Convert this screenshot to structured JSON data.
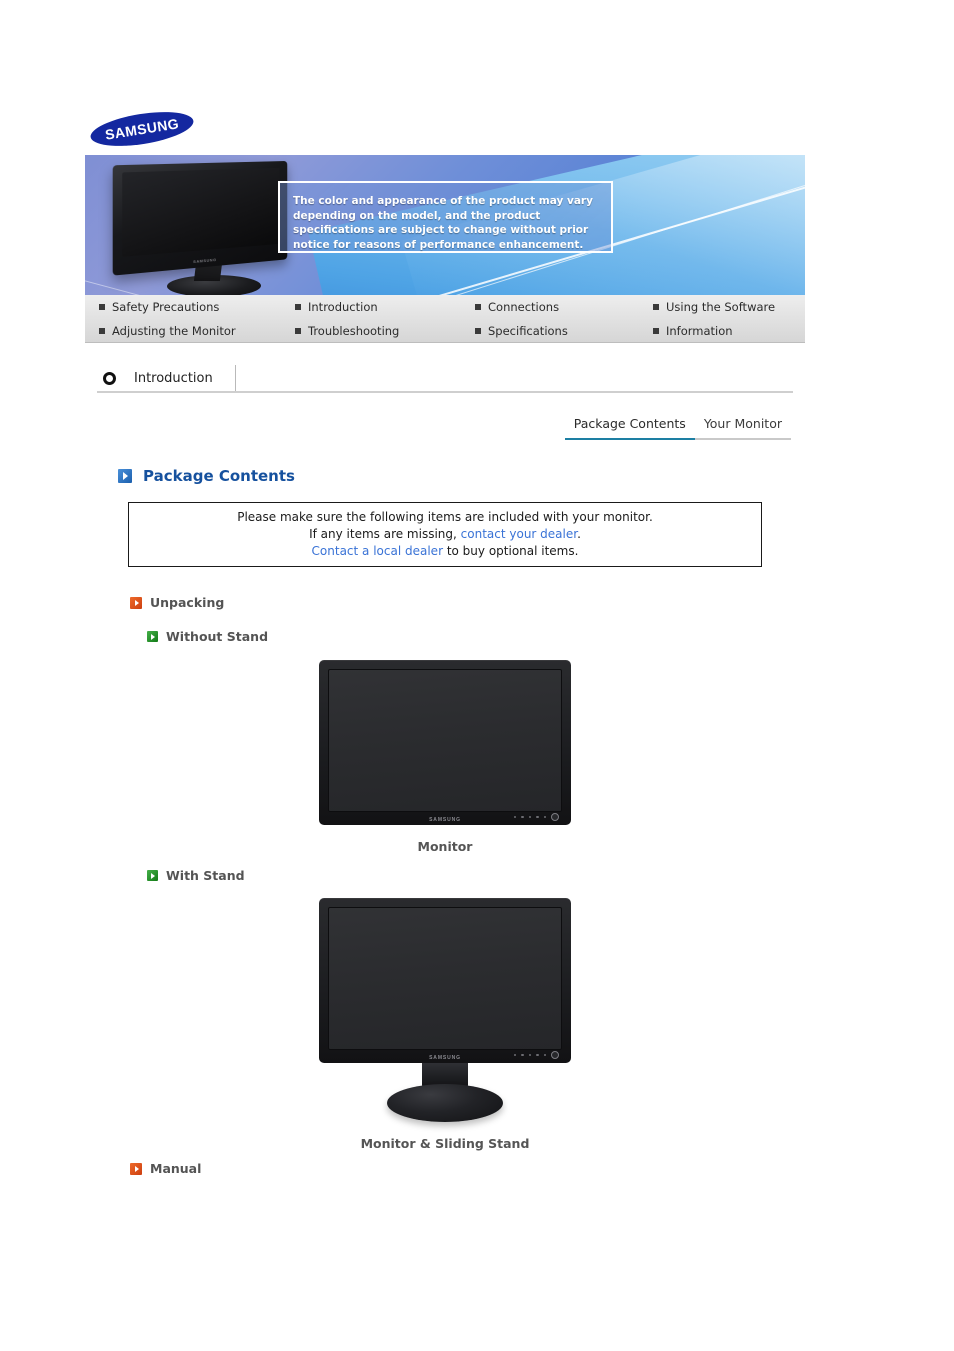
{
  "brand": {
    "logo_text": "SAMSUNG"
  },
  "banner": {
    "notice_text": "The color and appearance of the product may vary depending on the model, and the product specifications are subject to change without prior notice for reasons of performance enhancement.",
    "monitor_logo": "SAMSUNG"
  },
  "nav": {
    "items": [
      {
        "label": "Safety Precautions"
      },
      {
        "label": "Introduction"
      },
      {
        "label": "Connections"
      },
      {
        "label": "Using the Software"
      },
      {
        "label": "Adjusting the Monitor"
      },
      {
        "label": "Troubleshooting"
      },
      {
        "label": "Specifications"
      },
      {
        "label": "Information"
      }
    ]
  },
  "section": {
    "title": "Introduction"
  },
  "tabs": [
    {
      "label": "Package Contents",
      "active": true
    },
    {
      "label": "Your Monitor",
      "active": false
    }
  ],
  "package_contents": {
    "heading": "Package Contents",
    "notice": {
      "line1": "Please make sure the following items are included with your monitor.",
      "line2_prefix": "If any items are missing, ",
      "line2_link": "contact your dealer",
      "line2_suffix": ".",
      "line3_link": "Contact a local dealer",
      "line3_suffix": " to buy optional items."
    },
    "unpacking_label": "Unpacking",
    "without_stand_label": "Without Stand",
    "with_stand_label": "With Stand",
    "manual_label": "Manual",
    "figures": [
      {
        "caption": "Monitor",
        "monitor_logo": "SAMSUNG"
      },
      {
        "caption": "Monitor & Sliding Stand",
        "monitor_logo": "SAMSUNG"
      }
    ]
  },
  "colors": {
    "brand_blue": "#1428a0",
    "heading_blue": "#16519e",
    "link_blue": "#3a73d6",
    "active_tab_underline": "#1d7fa3",
    "unpacking_icon": "#cc3f10",
    "stand_icon": "#127a16"
  }
}
